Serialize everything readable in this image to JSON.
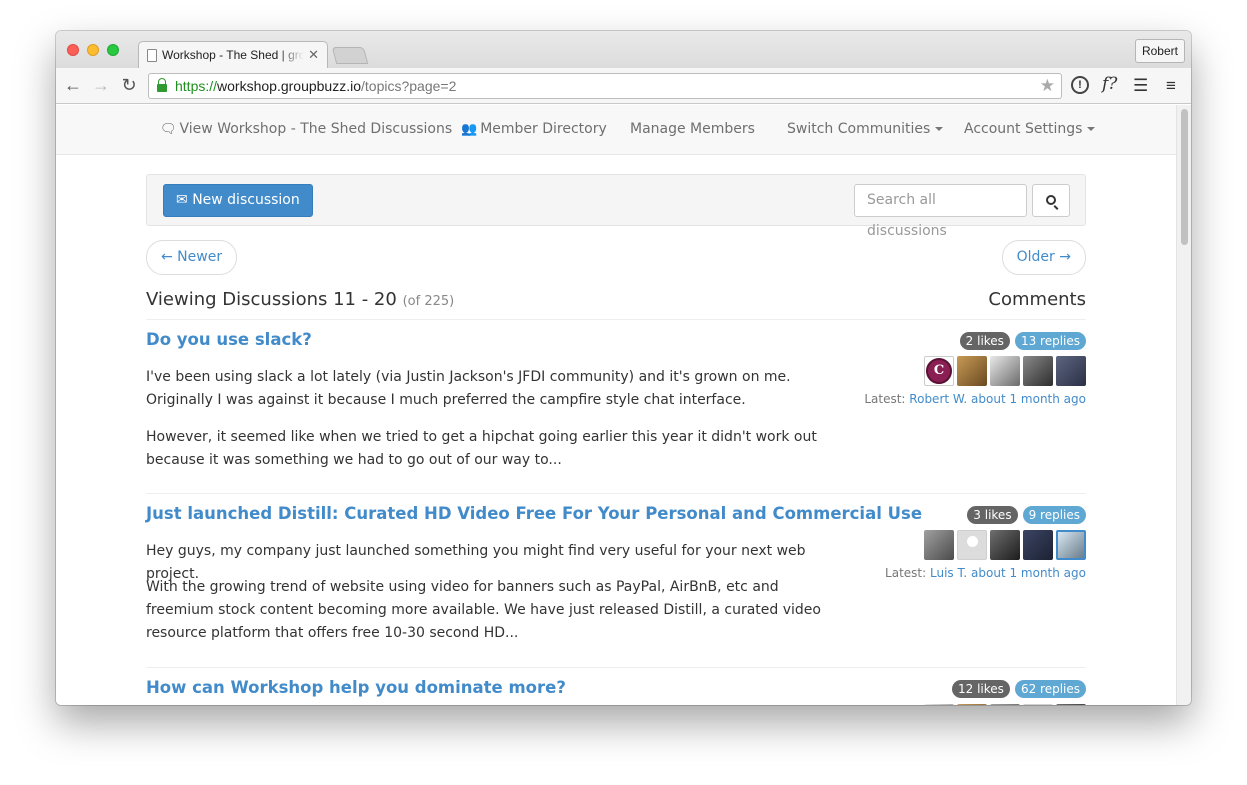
{
  "browser": {
    "tab_title": "Workshop - The Shed | groupbuzz",
    "profile_name": "Robert",
    "url": {
      "scheme": "https://",
      "host": "workshop.groupbuzz.io",
      "path": "/topics?page=2"
    },
    "extensions": [
      "info-icon",
      "font-f-icon",
      "buffer-stack-icon"
    ],
    "menu_icon": "hamburger-menu-icon"
  },
  "sitenav": {
    "view_discussions": "View Workshop - The Shed Discussions",
    "member_directory": "Member Directory",
    "manage_members": "Manage Members",
    "switch_communities": "Switch Communities",
    "account_settings": "Account Settings"
  },
  "actions": {
    "new_discussion": "New discussion",
    "search_placeholder": "Search all discussions"
  },
  "pager": {
    "newer": "← Newer",
    "older": "Older →"
  },
  "listing": {
    "heading": "Viewing Discussions 11 - 20",
    "total": "(of 225)",
    "comments_heading": "Comments"
  },
  "topics": [
    {
      "title": "Do you use slack?",
      "paragraphs": [
        "I've been using slack a lot lately (via Justin Jackson's JFDI community) and it's grown on me. Originally I was against it because I much preferred the campfire style chat interface.",
        "However, it seemed like when we tried to get a hipchat going earlier this year it didn't work out because it was something we had to go out of our way to..."
      ],
      "likes": "2 likes",
      "replies": "13 replies",
      "latest_label": "Latest:",
      "latest_user": "Robert W.",
      "latest_time": "about 1 month ago"
    },
    {
      "title": "Just launched Distill: Curated HD Video Free For Your Personal and Commercial Use",
      "paragraphs": [
        "Hey guys, my company just launched something you might find very useful for your next web project.",
        "With the growing trend of website using video for banners such as PayPal, AirBnB, etc and freemium stock content becoming more available. We have just released Distill, a curated video resource platform that offers free 10-30 second HD..."
      ],
      "likes": "3 likes",
      "replies": "9 replies",
      "latest_label": "Latest:",
      "latest_user": "Luis T.",
      "latest_time": "about 1 month ago"
    },
    {
      "title": "How can Workshop help you dominate more?",
      "likes": "12 likes",
      "replies": "62 replies"
    }
  ]
}
